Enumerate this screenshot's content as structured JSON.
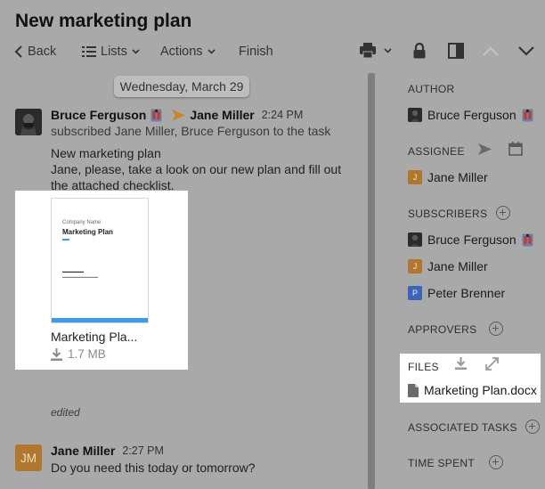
{
  "window": {
    "title": "New marketing plan"
  },
  "toolbar": {
    "back_label": "Back",
    "lists_label": "Lists",
    "actions_label": "Actions",
    "finish_label": "Finish"
  },
  "feed": {
    "date_separator": "Wednesday, March 29",
    "messages": [
      {
        "author": "Bruce Ferguson",
        "recipient": "Jane Miller",
        "time": "2:24 PM",
        "subline": "subscribed Jane Miller, Bruce Ferguson to the task",
        "body_lines": [
          "New marketing plan",
          "Jane, please, take a look on our new plan and fill out",
          "the attached checklist."
        ],
        "attachment": {
          "thumb_company": "Company Name",
          "thumb_title": "Marketing Plan",
          "name": "Marketing Pla...",
          "size": "1.7 MB"
        },
        "edited_label": "edited"
      },
      {
        "author": "Jane Miller",
        "initials": "JM",
        "time": "2:27 PM",
        "body": "Do you need this today or tomorrow?"
      }
    ]
  },
  "sidebar": {
    "author_label": "AUTHOR",
    "author": "Bruce Ferguson",
    "assignee_label": "ASSIGNEE",
    "assignee": {
      "name": "Jane Miller",
      "initial": "J"
    },
    "subscribers_label": "SUBSCRIBERS",
    "subscribers": [
      {
        "name": "Bruce Ferguson",
        "initial": ""
      },
      {
        "name": "Jane Miller",
        "initial": "J"
      },
      {
        "name": "Peter Brenner",
        "initial": "P"
      }
    ],
    "approvers_label": "APPROVERS",
    "files_label": "FILES",
    "file_name": "Marketing Plan.docx",
    "associated_label": "ASSOCIATED TASKS",
    "time_spent_label": "TIME SPENT"
  },
  "colors": {
    "overlay_bg": "#a9a9a9",
    "highlight": "#ffffff",
    "accent_arrow": "#c7862c",
    "jm_avatar": "#b2772f",
    "pb_avatar": "#3c66b5",
    "thumb_blue": "#3d9be9"
  },
  "icons": [
    "back-chevron-icon",
    "list-icon",
    "printer-icon",
    "lock-icon",
    "panel-toggle-icon",
    "chevron-up-icon",
    "chevron-down-icon",
    "send-icon",
    "calendar-icon",
    "download-icon",
    "expand-icon",
    "document-icon",
    "plus-circle-icon",
    "badge-icon"
  ]
}
